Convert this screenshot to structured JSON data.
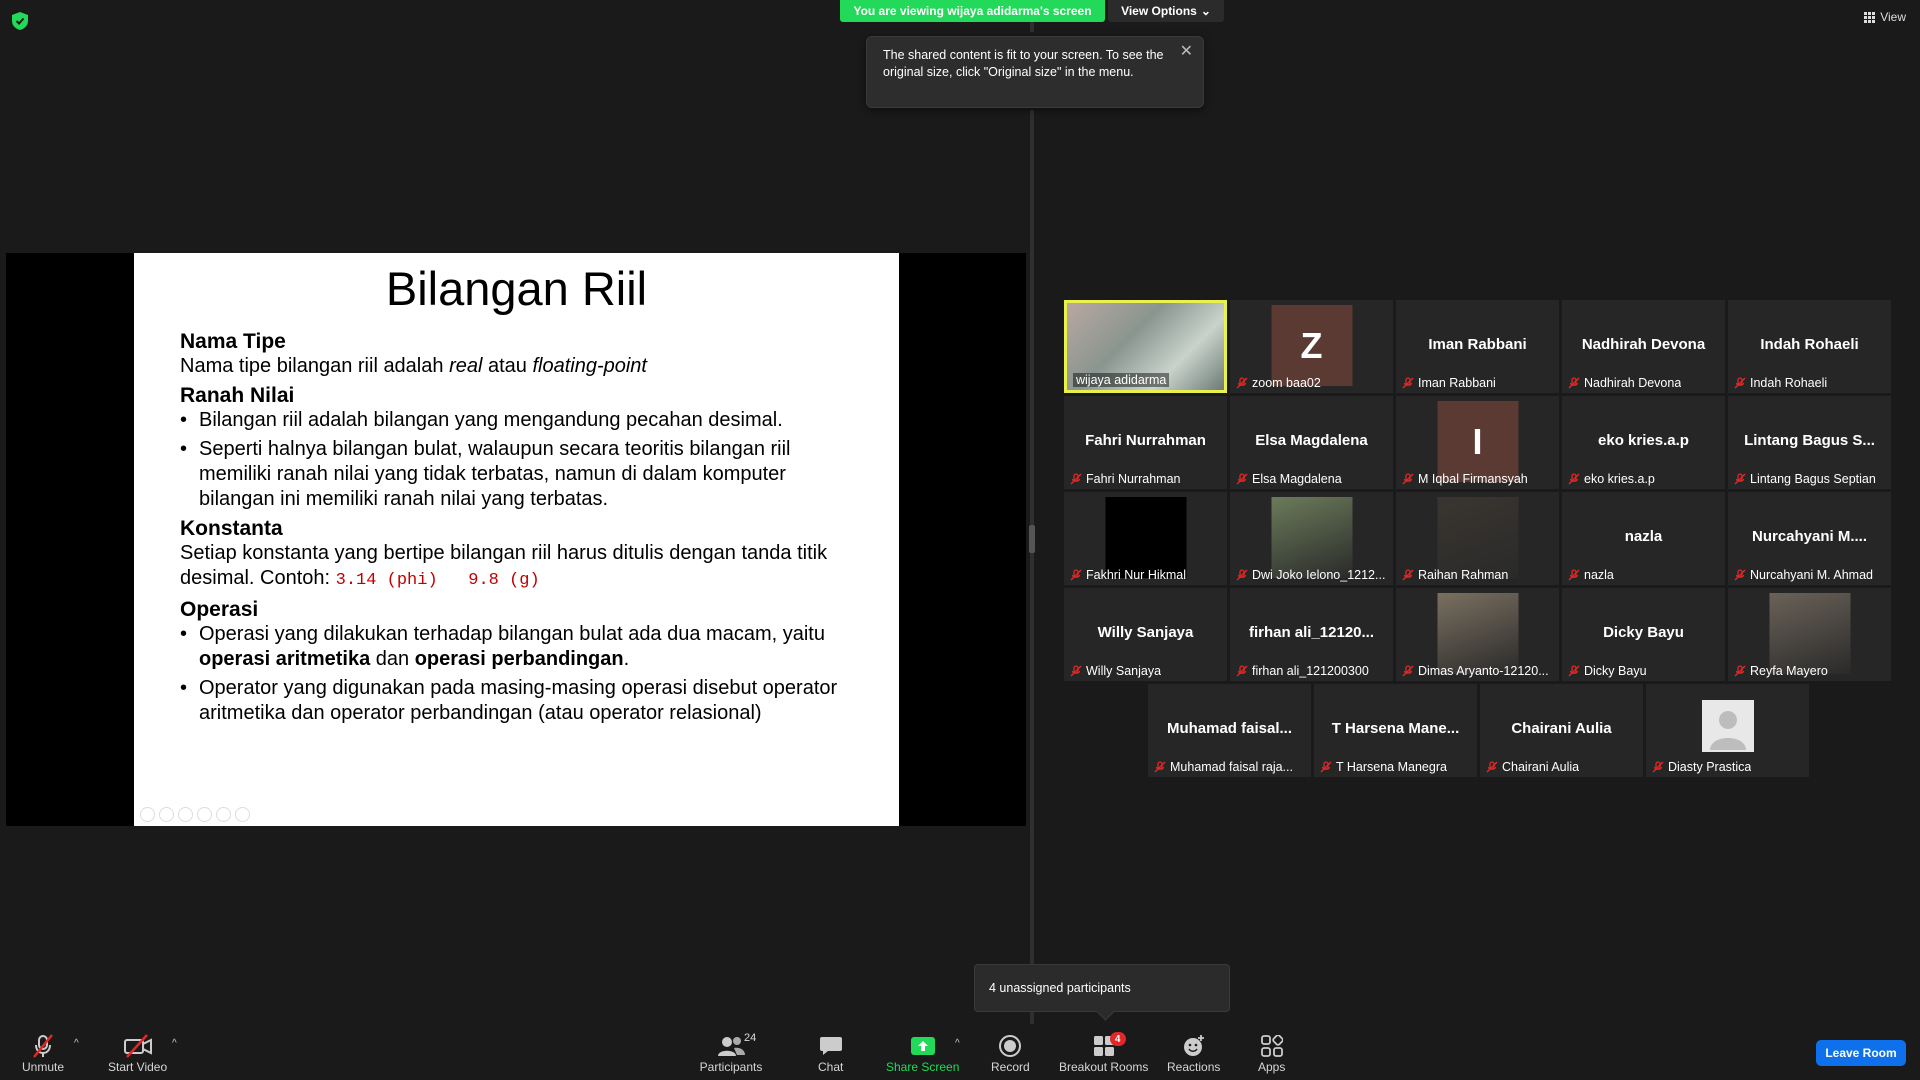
{
  "banner": {
    "viewing": "You are viewing wijaya adidarma's screen",
    "view_options": "View Options",
    "view_label": "View"
  },
  "tooltip": {
    "text": "The shared content is fit to your screen. To see the original size, click \"Original size\" in the menu."
  },
  "slide": {
    "title": "Bilangan Riil",
    "h_nama_tipe": "Nama Tipe",
    "nama_tipe_pre": "Nama tipe bilangan riil adalah ",
    "nama_tipe_real": "real",
    "nama_tipe_mid": " atau ",
    "nama_tipe_float": "floating-point",
    "h_ranah": "Ranah Nilai",
    "ranah_1": "Bilangan riil adalah bilangan yang mengandung pecahan desimal.",
    "ranah_2": "Seperti halnya bilangan bulat, walaupun secara teoritis bilangan riil memiliki ranah nilai yang tidak terbatas, namun di dalam komputer bilangan ini memiliki ranah nilai yang terbatas.",
    "h_konstanta": "Konstanta",
    "konstanta_text": "Setiap konstanta yang bertipe bilangan riil harus ditulis dengan tanda titik desimal. Contoh: ",
    "konstanta_code": "3.14 (phi)   9.8 (g)",
    "h_operasi": "Operasi",
    "operasi_1_pre": "Operasi yang dilakukan terhadap bilangan bulat ada dua macam, yaitu ",
    "operasi_1_b1": "operasi aritmetika",
    "operasi_1_mid": " dan ",
    "operasi_1_b2": "operasi perbandingan",
    "operasi_1_end": ".",
    "operasi_2": "Operator yang digunakan pada masing-masing operasi disebut operator aritmetika dan operator perbandingan (atau operator relasional)"
  },
  "participants": [
    {
      "center": "",
      "label": "wijaya adidarma",
      "muted": false,
      "kind": "photo",
      "color": "#9a8f86"
    },
    {
      "center": "",
      "label": "zoom baa02",
      "muted": true,
      "kind": "letter",
      "letter": "Z",
      "color": "#5a3a33"
    },
    {
      "center": "Iman Rabbani",
      "label": "Iman Rabbani",
      "muted": true,
      "kind": "name"
    },
    {
      "center": "Nadhirah Devona",
      "label": "Nadhirah Devona",
      "muted": true,
      "kind": "name"
    },
    {
      "center": "Indah Rohaeli",
      "label": "Indah Rohaeli",
      "muted": true,
      "kind": "name"
    },
    {
      "center": "Fahri Nurrahman",
      "label": "Fahri Nurrahman",
      "muted": true,
      "kind": "name"
    },
    {
      "center": "Elsa Magdalena",
      "label": "Elsa Magdalena",
      "muted": true,
      "kind": "name"
    },
    {
      "center": "",
      "label": "M Iqbal Firmansyah",
      "muted": true,
      "kind": "letter",
      "letter": "I",
      "color": "#5a3a33"
    },
    {
      "center": "eko kries.a.p",
      "label": "eko kries.a.p",
      "muted": true,
      "kind": "name"
    },
    {
      "center": "Lintang Bagus S...",
      "label": "Lintang Bagus Septian",
      "muted": true,
      "kind": "name"
    },
    {
      "center": "",
      "label": "Fakhri Nur Hikmal",
      "muted": true,
      "kind": "black"
    },
    {
      "center": "",
      "label": "Dwi Joko Ielono_1212...",
      "muted": true,
      "kind": "photo",
      "color": "#6b7b5a"
    },
    {
      "center": "",
      "label": "Raihan Rahman",
      "muted": true,
      "kind": "photo",
      "color": "#3a3530"
    },
    {
      "center": "nazla",
      "label": "nazla",
      "muted": true,
      "kind": "name"
    },
    {
      "center": "Nurcahyani  M....",
      "label": "Nurcahyani M. Ahmad",
      "muted": true,
      "kind": "name"
    },
    {
      "center": "Willy Sanjaya",
      "label": "Willy Sanjaya",
      "muted": true,
      "kind": "name"
    },
    {
      "center": "firhan  ali_12120...",
      "label": "firhan ali_121200300",
      "muted": true,
      "kind": "name"
    },
    {
      "center": "",
      "label": "Dimas Aryanto-12120...",
      "muted": true,
      "kind": "photo",
      "color": "#7a7060"
    },
    {
      "center": "Dicky Bayu",
      "label": "Dicky Bayu",
      "muted": true,
      "kind": "name"
    },
    {
      "center": "",
      "label": "Reyfa Mayero",
      "muted": true,
      "kind": "photo",
      "color": "#6a6258"
    },
    {
      "center": "Muhamad  faisal...",
      "label": "Muhamad faisal raja...",
      "muted": true,
      "kind": "name"
    },
    {
      "center": "T  Harsena  Mane...",
      "label": "T Harsena Manegra",
      "muted": true,
      "kind": "name"
    },
    {
      "center": "Chairani Aulia",
      "label": "Chairani Aulia",
      "muted": true,
      "kind": "name"
    },
    {
      "center": "",
      "label": "Diasty Prastica",
      "muted": true,
      "kind": "default-avatar"
    }
  ],
  "unassigned": "4 unassigned participants",
  "toolbar": {
    "unmute": "Unmute",
    "start_video": "Start Video",
    "participants": "Participants",
    "participants_count": "24",
    "chat": "Chat",
    "share_screen": "Share Screen",
    "record": "Record",
    "breakout_rooms": "Breakout Rooms",
    "breakout_badge": "4",
    "reactions": "Reactions",
    "apps": "Apps",
    "leave_room": "Leave Room"
  },
  "colors": {
    "banner_green": "#23d959",
    "active_border": "#e8f24a",
    "leave_blue": "#0e71eb",
    "mute_red": "#e02828"
  }
}
